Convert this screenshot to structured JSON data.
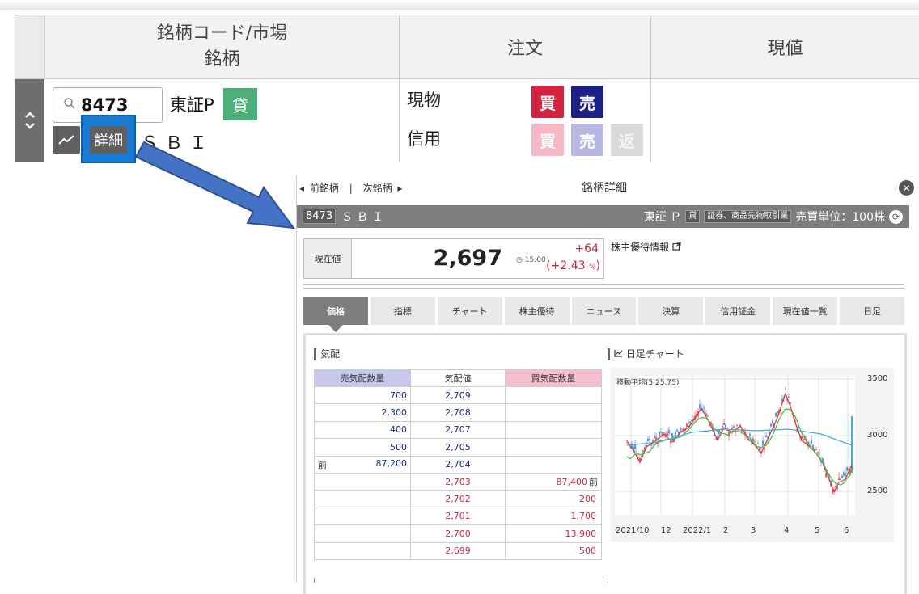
{
  "order_table": {
    "headers": {
      "code_line1": "銘柄コード/市場",
      "code_line2": "銘柄",
      "order": "注文",
      "price": "現値"
    },
    "row": {
      "code_value": "8473",
      "market": "東証P",
      "kashi_badge": "貸",
      "detail_label": "詳細",
      "name": "ＳＢＩ",
      "order_types": [
        "現物",
        "信用"
      ],
      "buttons": {
        "buy": "買",
        "sell": "売",
        "repay": "返"
      }
    }
  },
  "panel": {
    "prev_label": "前銘柄",
    "next_label": "次銘柄",
    "separator": "|",
    "title": "銘柄詳細",
    "code": "8473",
    "name": "ＳＢＩ",
    "market": "東証 Ｐ",
    "badge": "貸",
    "sector": "証券、商品先物取引業",
    "unit": "売買単位：100株",
    "price_label": "現在値",
    "price": "2,697",
    "time": "15:00",
    "change": "+64",
    "change_pct": "(+2.43",
    "pct_unit": "%",
    "pct_close": ")",
    "yutai_link": "株主優待情報",
    "tabs": [
      "価格",
      "指標",
      "チャート",
      "株主優待",
      "ニュース",
      "決算",
      "信用証金",
      "現在値一覧",
      "日足"
    ],
    "active_tab": 0
  },
  "order_book": {
    "title": "気配",
    "headers": [
      "売気配数量",
      "気配値",
      "買気配数量"
    ],
    "rows": [
      {
        "sell_prefix": "",
        "sell": "700",
        "price": "2,709",
        "buy": "",
        "buy_suffix": "",
        "side": "sell"
      },
      {
        "sell_prefix": "",
        "sell": "2,300",
        "price": "2,708",
        "buy": "",
        "buy_suffix": "",
        "side": "sell"
      },
      {
        "sell_prefix": "",
        "sell": "400",
        "price": "2,707",
        "buy": "",
        "buy_suffix": "",
        "side": "sell"
      },
      {
        "sell_prefix": "",
        "sell": "500",
        "price": "2,705",
        "buy": "",
        "buy_suffix": "",
        "side": "sell"
      },
      {
        "sell_prefix": "前",
        "sell": "87,200",
        "price": "2,704",
        "buy": "",
        "buy_suffix": "",
        "side": "sell"
      },
      {
        "sell_prefix": "",
        "sell": "",
        "price": "2,703",
        "buy": "87,400",
        "buy_suffix": "前",
        "side": "buy"
      },
      {
        "sell_prefix": "",
        "sell": "",
        "price": "2,702",
        "buy": "200",
        "buy_suffix": "",
        "side": "buy"
      },
      {
        "sell_prefix": "",
        "sell": "",
        "price": "2,701",
        "buy": "1,700",
        "buy_suffix": "",
        "side": "buy"
      },
      {
        "sell_prefix": "",
        "sell": "",
        "price": "2,700",
        "buy": "13,900",
        "buy_suffix": "",
        "side": "buy"
      },
      {
        "sell_prefix": "",
        "sell": "",
        "price": "2,699",
        "buy": "500",
        "buy_suffix": "",
        "side": "buy"
      }
    ]
  },
  "daily_chart": {
    "title": "日足チャート",
    "ma_label": "移動平均(5,25,75)",
    "y_ticks": [
      "3500",
      "3000",
      "2500"
    ],
    "x_ticks": [
      "2021/10",
      "12",
      "2022/1",
      "2",
      "3",
      "4",
      "5",
      "6"
    ]
  },
  "colors": {
    "buy_red": "#c62a45",
    "sell_navy": "#1e2a80",
    "kashi_green": "#4caf7a",
    "highlight_blue": "#1a7bd4",
    "arrow_blue": "#4472c4"
  }
}
